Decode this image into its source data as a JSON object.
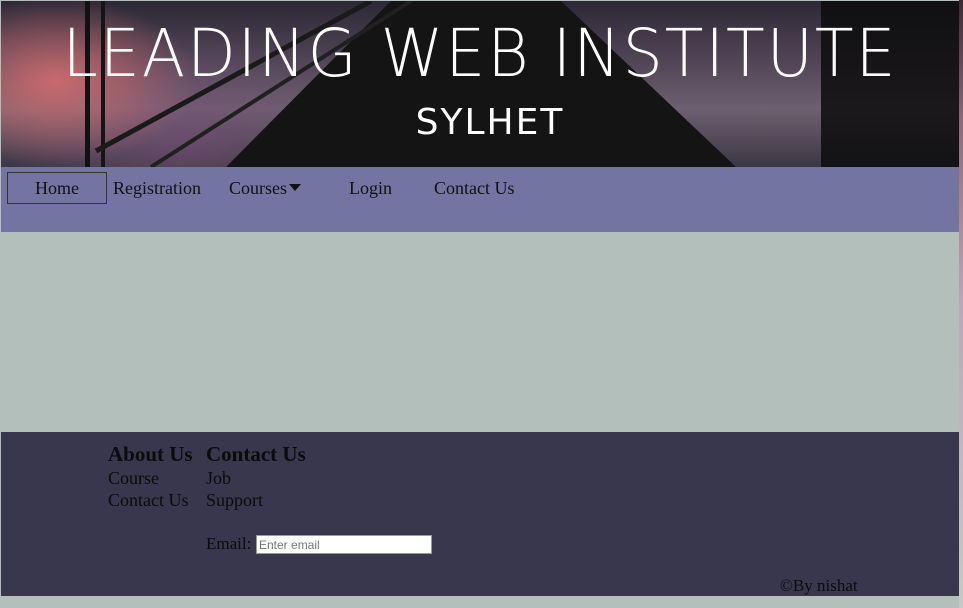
{
  "banner": {
    "title": "LEADING WEB INSTITUTE",
    "subtitle": "SYLHET"
  },
  "nav": {
    "items": [
      {
        "label": "Home",
        "active": true
      },
      {
        "label": "Registration"
      },
      {
        "label": "Courses",
        "has_dropdown": true
      },
      {
        "label": "Login"
      },
      {
        "label": "Contact Us"
      }
    ]
  },
  "footer": {
    "columns": [
      {
        "heading": "About Us",
        "links": [
          "Course",
          "Contact Us"
        ]
      },
      {
        "heading": "Contact Us",
        "links": [
          "Job",
          "Support"
        ]
      }
    ],
    "email_label": "Email:",
    "email_placeholder": "Enter email",
    "email_value": "",
    "copyright": "©By nishat"
  },
  "colors": {
    "nav_bg": "#7474a2",
    "content_bg": "#b2bfba",
    "footer_bg": "#38374d"
  }
}
